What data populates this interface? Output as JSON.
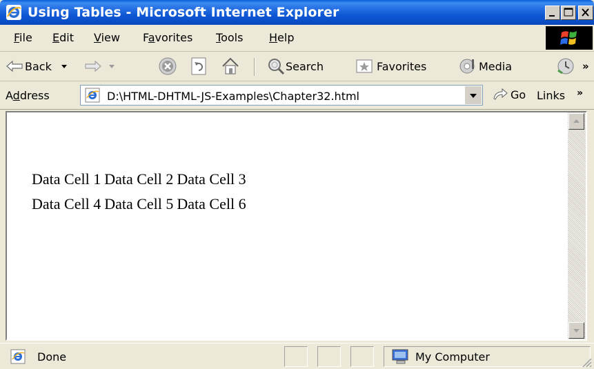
{
  "window": {
    "title": "Using Tables - Microsoft Internet Explorer"
  },
  "menu": {
    "items": [
      {
        "label_pre": "",
        "key": "F",
        "label_post": "ile"
      },
      {
        "label_pre": "",
        "key": "E",
        "label_post": "dit"
      },
      {
        "label_pre": "",
        "key": "V",
        "label_post": "iew"
      },
      {
        "label_pre": "F",
        "key": "a",
        "label_post": "vorites"
      },
      {
        "label_pre": "",
        "key": "T",
        "label_post": "ools"
      },
      {
        "label_pre": "",
        "key": "H",
        "label_post": "elp"
      }
    ]
  },
  "toolbar": {
    "back_label": "Back",
    "search_label": "Search",
    "favorites_label": "Favorites",
    "media_label": "Media",
    "chevron": "»"
  },
  "address": {
    "label_pre": "A",
    "label_key": "d",
    "label_post": "dress",
    "url": "D:\\HTML-DHTML-JS-Examples\\Chapter32.html",
    "go_label": "Go",
    "links_label": "Links",
    "links_chevron": "»"
  },
  "document": {
    "rows": [
      [
        "Data Cell 1",
        "Data Cell 2",
        "Data Cell 3"
      ],
      [
        "Data Cell 4",
        "Data Cell 5",
        "Data Cell 6"
      ]
    ]
  },
  "status": {
    "text": "Done",
    "zone": "My Computer"
  },
  "icons": {
    "app": "ie-logo-icon",
    "back": "back-arrow-icon",
    "forward": "forward-arrow-icon",
    "stop": "stop-icon",
    "refresh": "refresh-icon",
    "home": "home-icon",
    "search": "search-icon",
    "favorites": "favorites-icon",
    "media": "media-icon",
    "history": "history-icon",
    "zone": "computer-icon"
  },
  "colors": {
    "titlebar": "#0a4fc8",
    "chrome": "#ece9d8",
    "page": "#ffffff"
  }
}
